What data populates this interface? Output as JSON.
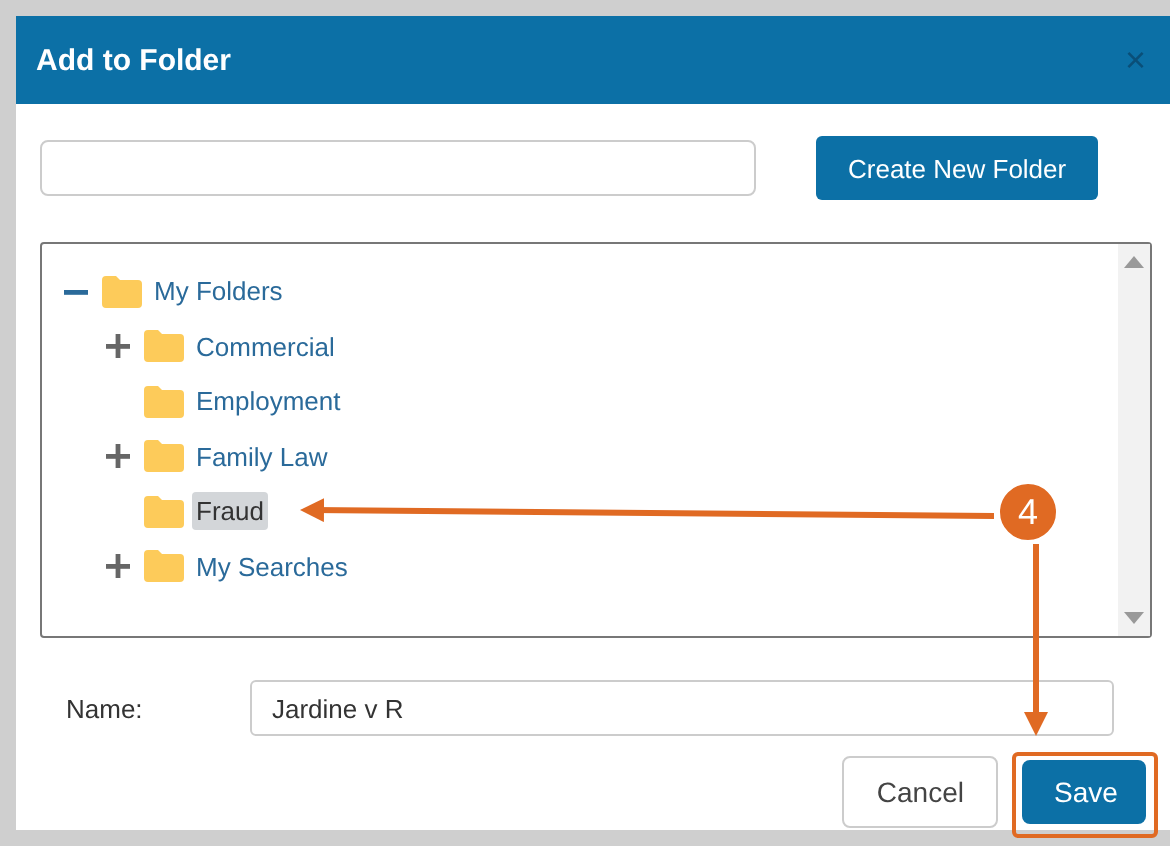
{
  "window": {
    "title": "Add to Folder",
    "close": "×"
  },
  "create_button": "Create New Folder",
  "tree": {
    "label": "My Folders",
    "kind": "expanded",
    "selected": false,
    "children": [
      {
        "label": "Commercial",
        "kind": "collapsed",
        "selected": false
      },
      {
        "label": "Employment",
        "kind": "leaf",
        "selected": false
      },
      {
        "label": "Family Law",
        "kind": "collapsed",
        "selected": false
      },
      {
        "label": "Fraud",
        "kind": "leaf",
        "selected": true
      },
      {
        "label": "My Searches",
        "kind": "collapsed",
        "selected": false
      }
    ]
  },
  "name_field": {
    "label": "Name:",
    "value": "Jardine v R"
  },
  "buttons": [
    {
      "label": "Cancel",
      "kind": "secondary"
    },
    {
      "label": "Save",
      "kind": "primary"
    }
  ],
  "annotation": {
    "label": "4"
  }
}
